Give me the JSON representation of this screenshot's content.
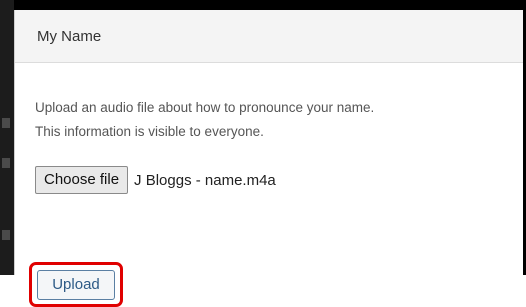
{
  "dialog": {
    "title": "My Name",
    "description_line1": "Upload an audio file about how to pronounce your name.",
    "description_line2": "This information is visible to everyone."
  },
  "file_input": {
    "button_label": "Choose file",
    "selected_file": "J Bloggs - name.m4a"
  },
  "actions": {
    "upload_label": "Upload",
    "highlight_color": "#e00000"
  }
}
